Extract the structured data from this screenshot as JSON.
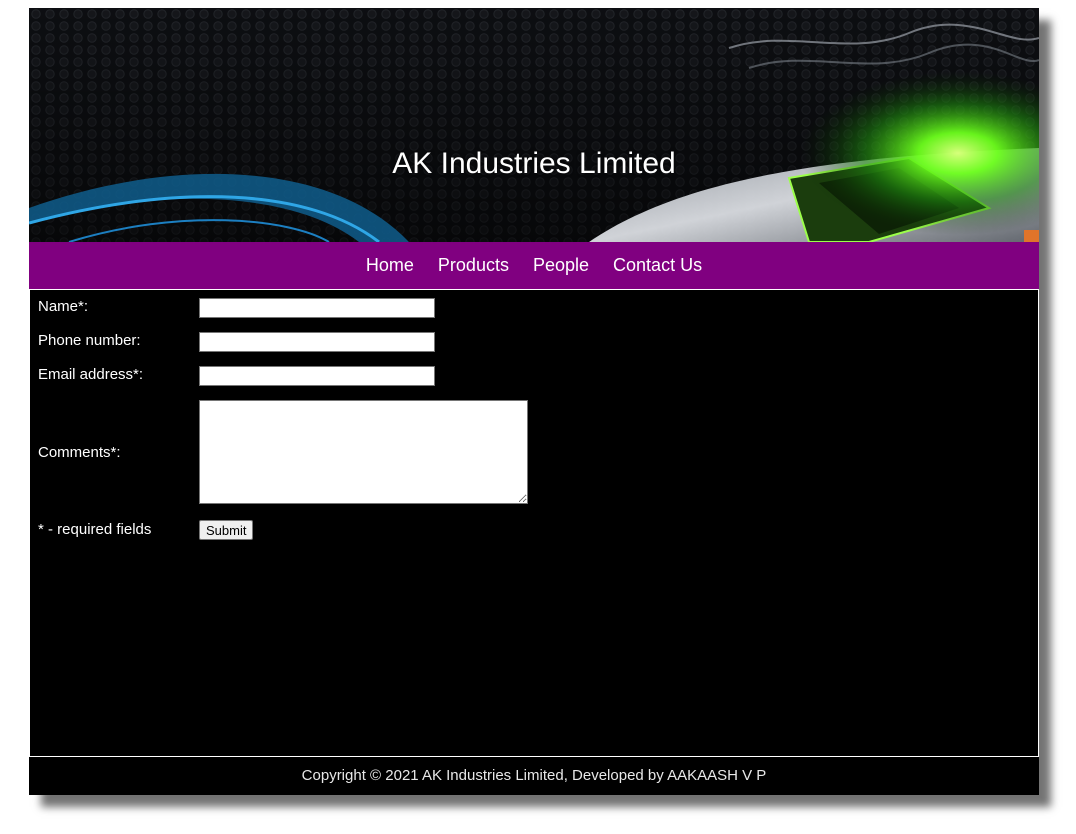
{
  "banner": {
    "title": "AK Industries Limited"
  },
  "nav": {
    "items": [
      {
        "label": "Home"
      },
      {
        "label": "Products"
      },
      {
        "label": "People"
      },
      {
        "label": "Contact Us"
      }
    ]
  },
  "form": {
    "name_label": "Name*:",
    "name_value": "",
    "phone_label": "Phone number:",
    "phone_value": "",
    "email_label": "Email address*:",
    "email_value": "",
    "comments_label": "Comments*:",
    "comments_value": "",
    "required_note": "* - required fields",
    "submit_label": "Submit"
  },
  "footer": {
    "text": "Copyright © 2021 AK Industries Limited, Developed by AAKAASH V P"
  },
  "colors": {
    "nav_background": "#800080",
    "page_background": "#000000",
    "accent_green": "#5fff1a"
  }
}
